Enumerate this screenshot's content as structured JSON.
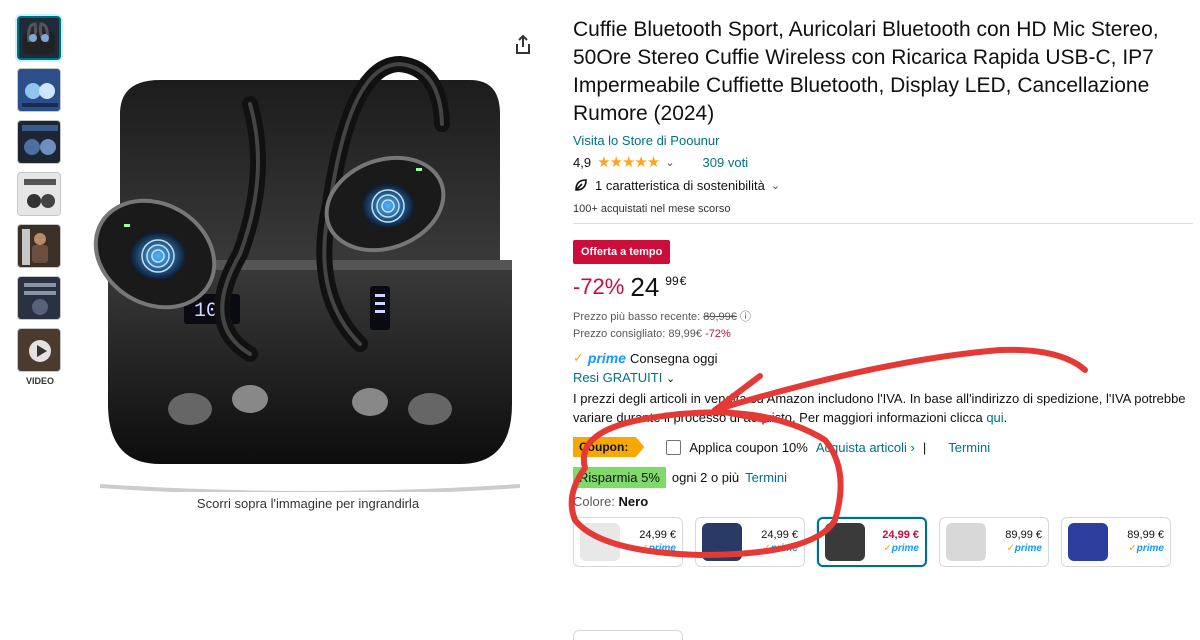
{
  "thumbnails": [
    {
      "icon": "earbuds-case-thumbnail",
      "selected": true
    },
    {
      "icon": "earbuds-features-thumbnail"
    },
    {
      "icon": "earbuds-features-thumbnail"
    },
    {
      "icon": "earbuds-features-thumbnail"
    },
    {
      "icon": "earbuds-sport-thumbnail"
    },
    {
      "icon": "earbuds-features-thumbnail"
    },
    {
      "icon": "video-thumbnail"
    }
  ],
  "video_label": "VIDEO",
  "zoom_hint": "Scorri sopra l'immagine per ingrandirla",
  "product": {
    "title": "Cuffie Bluetooth Sport, Auricolari Bluetooth con HD Mic Stereo, 50Ore Stereo Cuffie Wireless con Ricarica Rapida USB-C, IP7 Impermeabile Cuffiette Bluetooth, Display LED, Cancellazione Rumore (2024)",
    "store_link": "Visita lo Store di Poounur",
    "rating": "4,9",
    "stars": "★★★★★",
    "votes": "309 voti",
    "sustainability": "1 caratteristica di sostenibilità",
    "bought": "100+ acquistati nel mese scorso"
  },
  "deal_badge": "Offerta a tempo",
  "price": {
    "discount": "-72%",
    "whole": "24",
    "fraction": "99",
    "currency": "€",
    "lowest_label": "Prezzo più basso recente:",
    "lowest_value": "89,99€",
    "rrp_label": "Prezzo consigliato:",
    "rrp_value": "89,99€",
    "rrp_discount": "-72%"
  },
  "delivery": {
    "prime": "prime",
    "text": "Consegna oggi",
    "returns": "Resi GRATUITI"
  },
  "vat": {
    "text": "I prezzi degli articoli in vendita su Amazon includono l'IVA. In base all'indirizzo di spedizione, l'IVA potrebbe variare durante il processo di acquisto. Per maggiori informazioni clicca",
    "link": "qui",
    "end": "."
  },
  "coupon": {
    "tag": "Coupon:",
    "apply": "Applica coupon 10%",
    "shop": "Acquista articoli ›",
    "separator": "|",
    "terms": "Termini"
  },
  "save": {
    "badge": "Risparmia 5%",
    "text": "ogni 2 o più",
    "terms": "Termini"
  },
  "color": {
    "label": "Colore:",
    "value": "Nero"
  },
  "swatches": [
    {
      "price": "24,99 €",
      "prime": "prime",
      "tone": "#e8e8e8",
      "selected": false
    },
    {
      "price": "24,99 €",
      "prime": "prime",
      "tone": "#2a3a66",
      "selected": false
    },
    {
      "price": "24,99 €",
      "prime": "prime",
      "tone": "#3a3a3a",
      "selected": true
    },
    {
      "price": "89,99 €",
      "prime": "prime",
      "tone": "#d8d8d8",
      "selected": false
    },
    {
      "price": "89,99 €",
      "prime": "prime",
      "tone": "#2d3e9e",
      "selected": false
    }
  ],
  "colors": {
    "link": "#007185",
    "deal": "#cc0c39",
    "star": "#ffa41c",
    "prime": "#1399ff",
    "coupon": "#f7a800",
    "save": "#7fda69",
    "annotation": "#e53935"
  }
}
